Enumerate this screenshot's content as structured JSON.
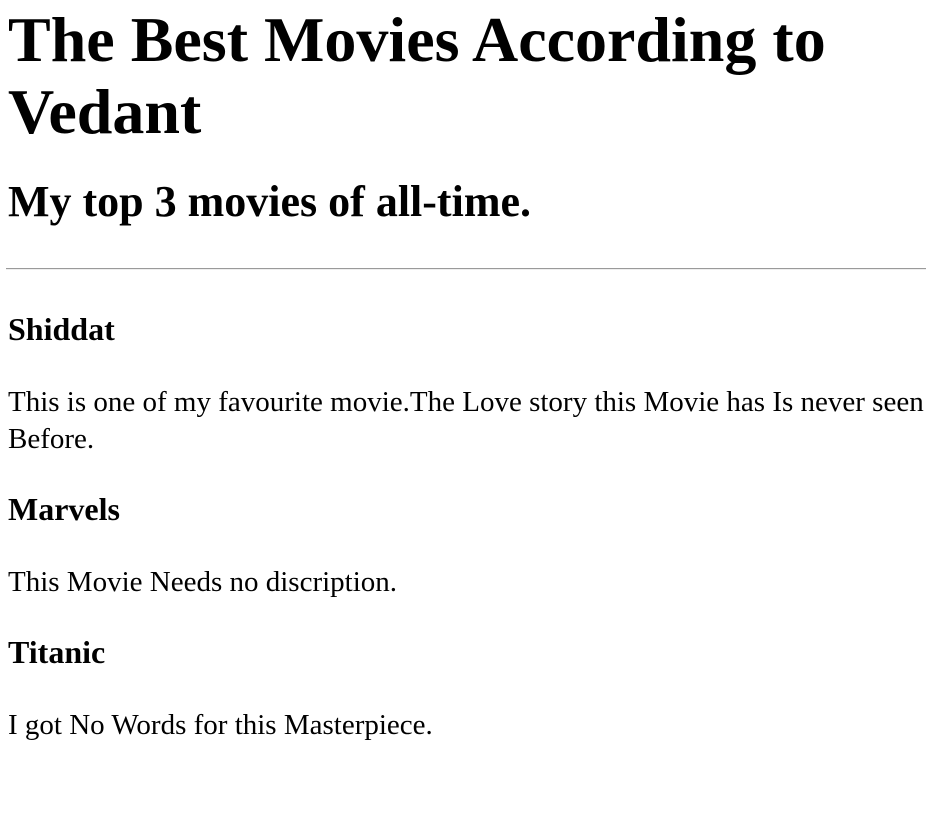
{
  "page": {
    "title": "The Best Movies According to Vedant",
    "subtitle": "My top 3 movies of all-time."
  },
  "movies": [
    {
      "title": "Shiddat",
      "description": "This is one of my favourite movie.The Love story this Movie has Is never seen Before."
    },
    {
      "title": "Marvels",
      "description": "This Movie Needs no discription."
    },
    {
      "title": "Titanic",
      "description": "I got No Words for this Masterpiece."
    }
  ]
}
